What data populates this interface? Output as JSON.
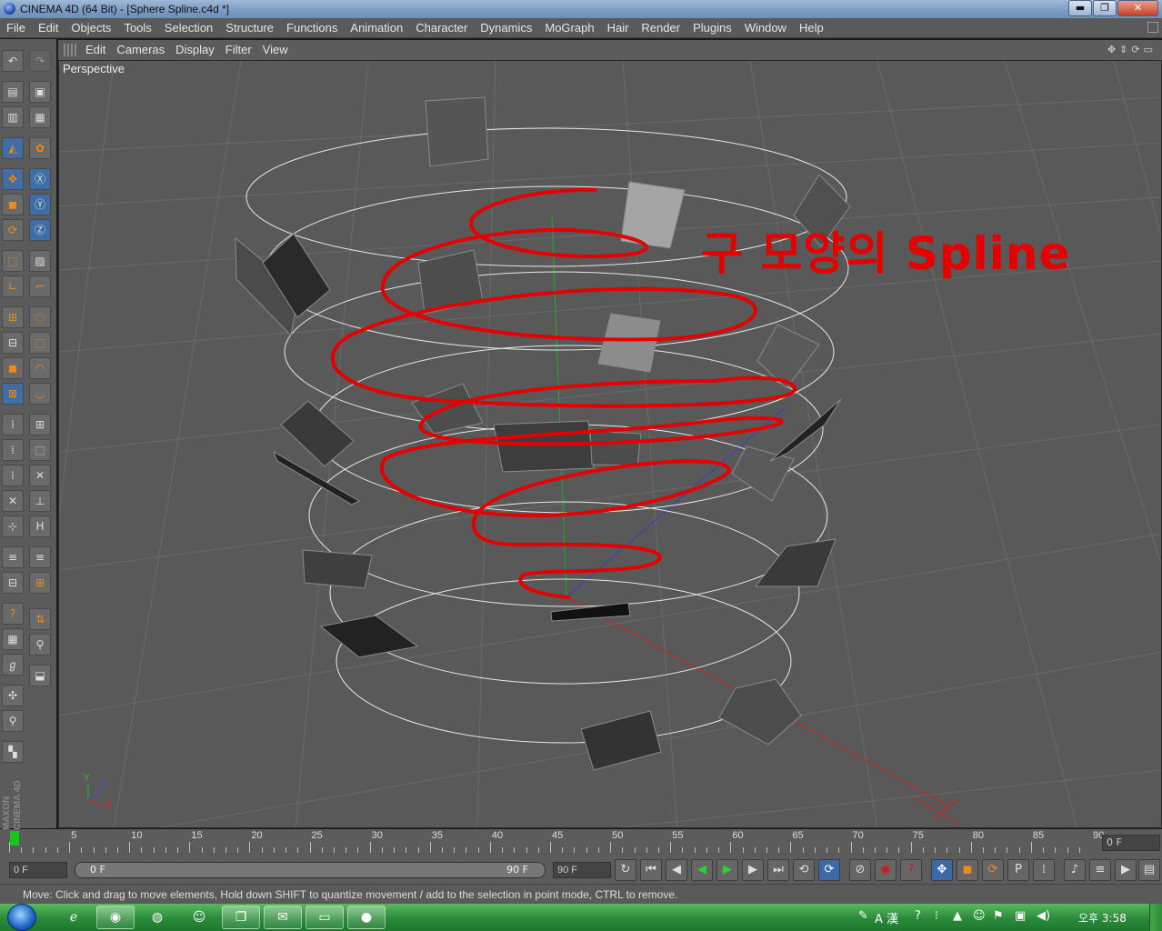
{
  "window": {
    "title": "CINEMA 4D (64 Bit) - [Sphere Spline.c4d *]",
    "controls": {
      "minimize": "▬",
      "maximize": "❐",
      "close": "✕"
    }
  },
  "menu": [
    "File",
    "Edit",
    "Objects",
    "Tools",
    "Selection",
    "Structure",
    "Functions",
    "Animation",
    "Character",
    "Dynamics",
    "MoGraph",
    "Hair",
    "Render",
    "Plugins",
    "Window",
    "Help"
  ],
  "viewport": {
    "menu": [
      "Edit",
      "Cameras",
      "Display",
      "Filter",
      "View"
    ],
    "label": "Perspective",
    "annotation": "구 모양의 Spline",
    "nav_icons": [
      "move-view-icon",
      "zoom-view-icon",
      "rotate-view-icon",
      "maximize-view-icon"
    ],
    "axis_labels": {
      "x": "X",
      "y": "Y",
      "z": "Z"
    }
  },
  "colors": {
    "ui_bg": "#5b5b5b",
    "viewport_bg": "#595959",
    "annotation_red": "#e50000",
    "accent_blue": "#3f6ea6",
    "play_green": "#2ad42f",
    "axis_x": "#e02020",
    "axis_y": "#20c020",
    "axis_z": "#3050e0"
  },
  "toolbar_tools": [
    "undo-icon",
    "redo-icon",
    "render-view-icon",
    "render-settings-icon",
    "render-picture-icon",
    "edit-render-icon",
    "model-mode-icon",
    "object-axis-icon",
    "move-tool-icon",
    "x-axis-lock-icon",
    "scale-tool-icon",
    "y-axis-lock-icon",
    "rotate-tool-icon",
    "z-axis-lock-icon",
    "coordinate-system-icon",
    "texture-mode-icon",
    "axis-mode-icon",
    "tweak-mode-icon",
    "points-mode-icon",
    "live-selection-icon",
    "edges-mode-icon",
    "rectangle-selection-icon",
    "polygons-mode-icon",
    "lasso-selection-icon",
    "uvw-mode-icon",
    "polygon-selection-icon"
  ],
  "timeline": {
    "ticks": [
      "0",
      "5",
      "10",
      "15",
      "20",
      "25",
      "30",
      "35",
      "40",
      "45",
      "50",
      "55",
      "60",
      "65",
      "70",
      "75",
      "80",
      "85",
      "90"
    ],
    "current_frame": "0 F"
  },
  "transport": {
    "start_field": "0 F",
    "range_start": "0 F",
    "range_end": "90 F",
    "end_field": "90 F",
    "buttons": [
      {
        "name": "loop-icon",
        "glyph": "↻"
      },
      {
        "name": "goto-start-icon",
        "glyph": "⏮"
      },
      {
        "name": "previous-frame-icon",
        "glyph": "◀"
      },
      {
        "name": "play-backwards-icon",
        "glyph": "◀"
      },
      {
        "name": "play-forwards-icon",
        "glyph": "▶"
      },
      {
        "name": "next-frame-icon",
        "glyph": "▶"
      },
      {
        "name": "goto-end-icon",
        "glyph": "⏭"
      },
      {
        "name": "repeat-icon",
        "glyph": "⟲"
      },
      {
        "name": "record-mode-icon",
        "glyph": "⟳"
      },
      {
        "name": "record-keys-icon",
        "glyph": "⊘"
      },
      {
        "name": "autokey-icon",
        "glyph": "◉"
      },
      {
        "name": "keyframe-selection-icon",
        "glyph": "?"
      },
      {
        "name": "position-key-icon",
        "glyph": "✥"
      },
      {
        "name": "scale-key-icon",
        "glyph": "◼"
      },
      {
        "name": "rotation-key-icon",
        "glyph": "⟳"
      },
      {
        "name": "parameter-key-icon",
        "glyph": "P"
      },
      {
        "name": "point-level-key-icon",
        "glyph": "⁞"
      },
      {
        "name": "motion-system-icon",
        "glyph": "♪"
      },
      {
        "name": "timeline-icon",
        "glyph": "≡"
      },
      {
        "name": "render-active-icon",
        "glyph": "▶"
      },
      {
        "name": "render-all-icon",
        "glyph": "▤"
      }
    ]
  },
  "status": "Move: Click and drag to move elements, Hold down SHIFT to quantize movement / add to the selection in point mode, CTRL to remove.",
  "taskbar": {
    "apps": [
      {
        "name": "internet-explorer-icon",
        "glyph": "ℯ"
      },
      {
        "name": "chrome-icon",
        "glyph": "◉"
      },
      {
        "name": "firefox-icon",
        "glyph": "◍"
      },
      {
        "name": "messenger-icon",
        "glyph": "☺"
      },
      {
        "name": "explorer-copy-icon",
        "glyph": "❐"
      },
      {
        "name": "chat-icon",
        "glyph": "✉"
      },
      {
        "name": "folder-icon",
        "glyph": "▭"
      },
      {
        "name": "cinema4d-icon",
        "glyph": "●"
      }
    ],
    "tray_lang": "A 漢",
    "clock": "오후 3:58"
  }
}
